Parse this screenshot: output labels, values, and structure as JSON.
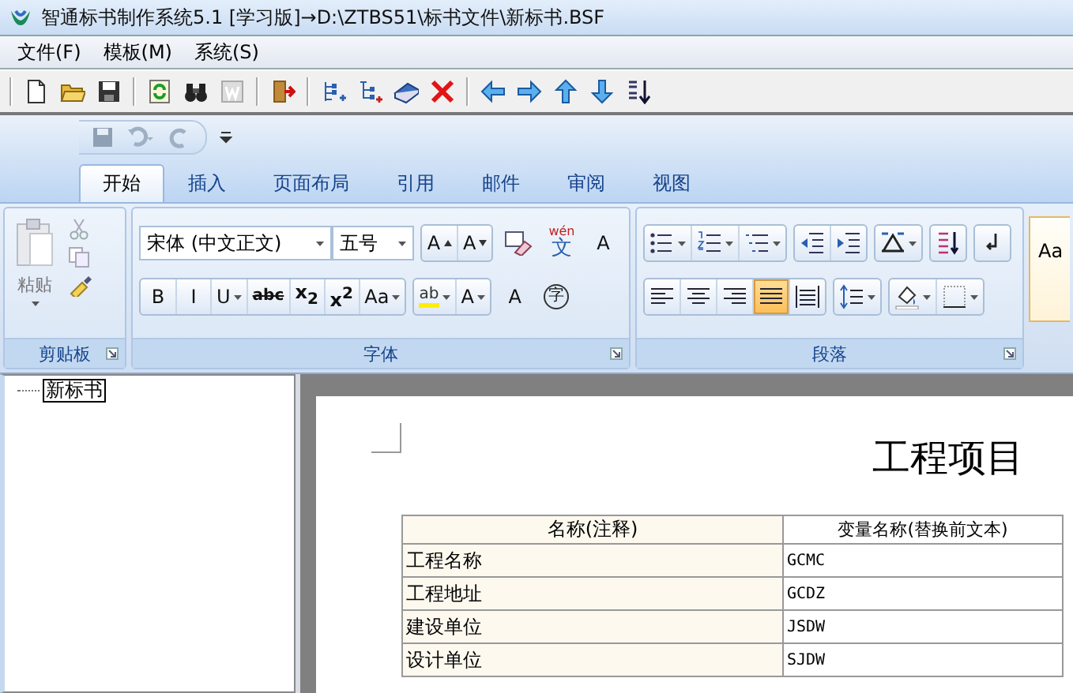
{
  "window": {
    "title": "智通标书制作系统5.1 [学习版]→D:\\ZTBS51\\标书文件\\新标书.BSF"
  },
  "menu": [
    "文件(F)",
    "模板(M)",
    "系统(S)"
  ],
  "ribbon": {
    "tabs": [
      {
        "label": "开始",
        "selected": true
      },
      {
        "label": "插入",
        "selected": false
      },
      {
        "label": "页面布局",
        "selected": false
      },
      {
        "label": "引用",
        "selected": false
      },
      {
        "label": "邮件",
        "selected": false
      },
      {
        "label": "审阅",
        "selected": false
      },
      {
        "label": "视图",
        "selected": false
      }
    ],
    "clipboard": {
      "label": "剪贴板",
      "paste_label": "粘贴"
    },
    "font": {
      "label": "字体",
      "font_name": "宋体 (中文正文)",
      "font_size": "五号",
      "row1": [
        {
          "kind": "grow",
          "label": "A"
        },
        {
          "kind": "shrink",
          "label": "A"
        },
        {
          "kind": "clear"
        },
        {
          "kind": "phonetic",
          "label": "文",
          "ruby": "wén"
        },
        {
          "kind": "boxed",
          "label": "A"
        }
      ],
      "row2": [
        {
          "kind": "bold",
          "label": "B"
        },
        {
          "kind": "italic",
          "label": "I"
        },
        {
          "kind": "underline",
          "label": "U",
          "menu": true
        },
        {
          "kind": "strike",
          "label": "abc"
        },
        {
          "kind": "sub",
          "label": "x$_{2}$"
        },
        {
          "kind": "sup",
          "label": "x$^{2}$"
        },
        {
          "kind": "case",
          "label": "Aa",
          "menu": true
        },
        {
          "kind": "highlight",
          "label": "ab",
          "menu": true
        },
        {
          "kind": "fontcolor",
          "label": "A",
          "menu": true
        },
        {
          "kind": "shaded",
          "label": "A"
        },
        {
          "kind": "enclosed",
          "label": "字"
        }
      ]
    },
    "paragraph": {
      "label": "段落",
      "align_buttons": [
        {
          "kind": "left",
          "selected": false
        },
        {
          "kind": "center",
          "selected": false
        },
        {
          "kind": "right",
          "selected": false
        },
        {
          "kind": "justify",
          "selected": true
        },
        {
          "kind": "distributed",
          "selected": false
        }
      ]
    },
    "styles": {
      "sample": "Aa"
    }
  },
  "tree": {
    "items": [
      {
        "label": "新标书",
        "selected": true
      }
    ]
  },
  "document": {
    "title": "工程项目",
    "table": {
      "columns": [
        "名称(注释)",
        "变量名称(替换前文本)"
      ],
      "rows": [
        [
          "工程名称",
          "GCMC"
        ],
        [
          "工程地址",
          "GCDZ"
        ],
        [
          "建设单位",
          "JSDW"
        ],
        [
          "设计单位",
          "SJDW"
        ]
      ]
    }
  }
}
